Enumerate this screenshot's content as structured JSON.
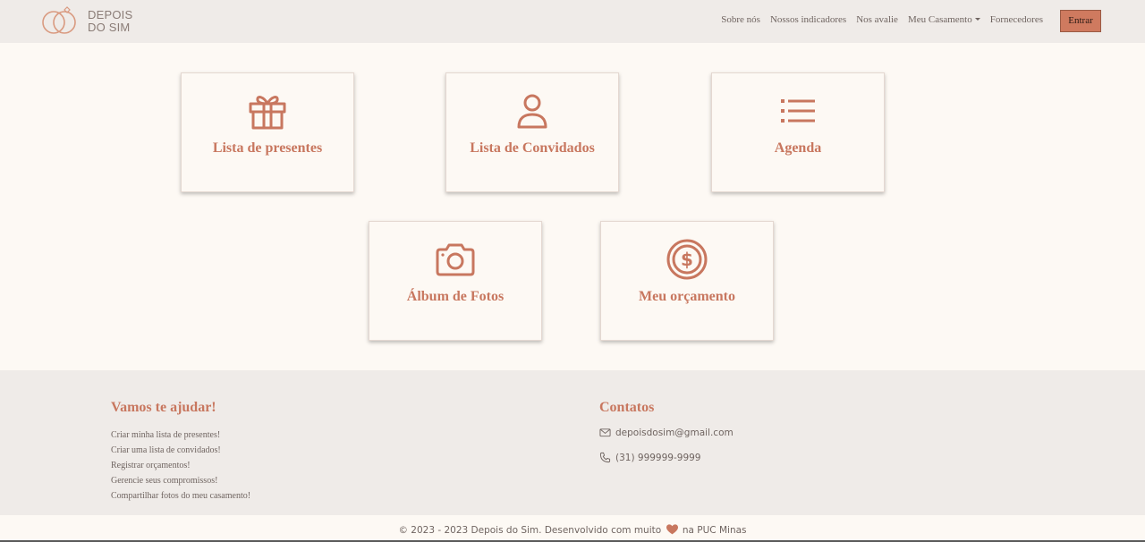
{
  "brand": {
    "line1": "DEPOIS",
    "line2": "DO SIM",
    "logo_icon": "rings-icon"
  },
  "nav": {
    "sobre": "Sobre nós",
    "indicadores": "Nossos indicadores",
    "avalie": "Nos avalie",
    "casamento": "Meu Casamento",
    "fornecedores": "Fornecedores",
    "entrar": "Entrar"
  },
  "cards": [
    {
      "label": "Lista de presentes",
      "icon": "gift-icon"
    },
    {
      "label": "Lista de Convidados",
      "icon": "person-icon"
    },
    {
      "label": "Agenda",
      "icon": "list-icon"
    },
    {
      "label": "Álbum de Fotos",
      "icon": "camera-icon"
    },
    {
      "label": "Meu orçamento",
      "icon": "dollar-coin-icon"
    }
  ],
  "footer": {
    "help_title": "Vamos te ajudar!",
    "help_items": [
      "Criar minha lista de presentes!",
      "Criar uma lista de convidados!",
      "Registrar orçamentos!",
      "Gerencie seus compromissos!",
      "Compartilhar fotos do meu casamento!"
    ],
    "contacts_title": "Contatos",
    "email": "depoisdosim@gmail.com",
    "phone": "(31) 999999-9999"
  },
  "copyright": {
    "before": "© 2023 - 2023 Depois do Sim. Desenvolvido com muito",
    "after": "na PUC Minas"
  },
  "colors": {
    "accent": "#c8775f",
    "button": "#cf7a5f",
    "nav_bg": "#efebe8",
    "page_bg": "#fdf9f4"
  }
}
